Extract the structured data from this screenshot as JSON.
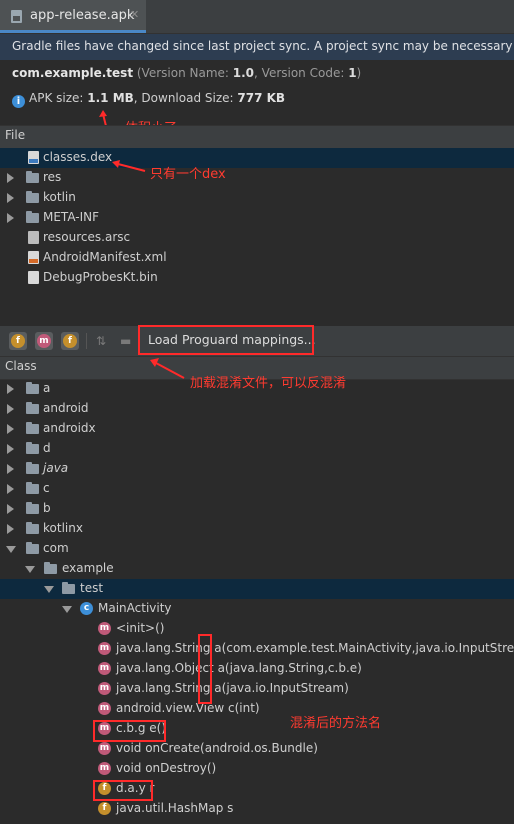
{
  "tab": {
    "title": "app-release.apk",
    "close": "✕",
    "icon": "apk-file-icon"
  },
  "banner": {
    "text": "Gradle files have changed since last project sync. A project sync may be necessary for"
  },
  "package": {
    "name": "com.example.test",
    "meta_open": " (Version Name: ",
    "version_name": "1.0",
    "meta_mid": ", Version Code: ",
    "version_code": "1",
    "meta_close": ")"
  },
  "size": {
    "label1": "APK size: ",
    "apk_size": "1.1 MB",
    "label2": ", Download Size: ",
    "download_size": "777 KB"
  },
  "file_panel": {
    "header": "File",
    "items": [
      {
        "label": "classes.dex",
        "type": "dex"
      },
      {
        "label": "res",
        "type": "folder"
      },
      {
        "label": "kotlin",
        "type": "folder"
      },
      {
        "label": "META-INF",
        "type": "folder"
      },
      {
        "label": "resources.arsc",
        "type": "arsc"
      },
      {
        "label": "AndroidManifest.xml",
        "type": "xml"
      },
      {
        "label": "DebugProbesKt.bin",
        "type": "bin"
      }
    ]
  },
  "toolbar": {
    "buttons": [
      "f",
      "m",
      "f"
    ],
    "load_mappings": "Load Proguard mappings..."
  },
  "class_panel": {
    "header": "Class",
    "packages": [
      "a",
      "android",
      "androidx",
      "d",
      "java",
      "c",
      "b",
      "kotlinx",
      "com",
      "example",
      "test"
    ],
    "class_name": "MainActivity",
    "class_badge": "c",
    "members": [
      {
        "badge": "m",
        "label": "<init>()"
      },
      {
        "badge": "m",
        "label": "java.lang.String a(com.example.test.MainActivity,java.io.InputStream)"
      },
      {
        "badge": "m",
        "label": "java.lang.Object a(java.lang.String,c.b.e)"
      },
      {
        "badge": "m",
        "label": "java.lang.String a(java.io.InputStream)"
      },
      {
        "badge": "m",
        "label": "android.view.View c(int)"
      },
      {
        "badge": "m",
        "label": "c.b.g e()"
      },
      {
        "badge": "m",
        "label": "void onCreate(android.os.Bundle)"
      },
      {
        "badge": "m",
        "label": "void onDestroy()"
      },
      {
        "badge": "f",
        "label": "d.a.y r"
      },
      {
        "badge": "f",
        "label": "java.util.HashMap s"
      }
    ]
  },
  "annotations": {
    "size_note": "体积小了",
    "dex_note": "只有一个dex",
    "mapping_note": "加载混淆文件，可以反混淆",
    "method_note": "混淆后的方法名"
  },
  "colors": {
    "annotation": "#ff2a2a",
    "selection": "#0d293e",
    "banner": "#2d3d51"
  }
}
